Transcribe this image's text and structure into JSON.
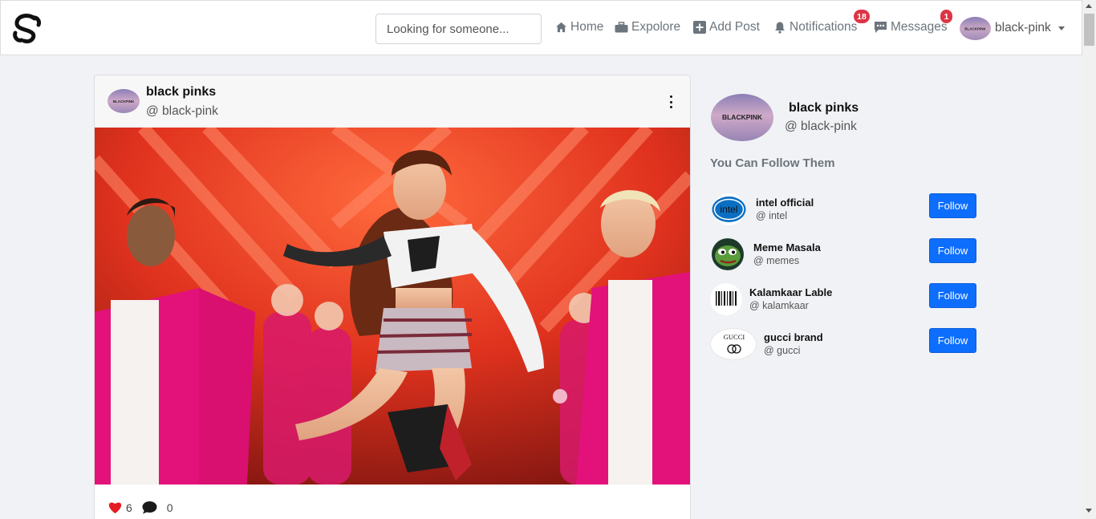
{
  "navbar": {
    "search_placeholder": "Looking for someone...",
    "items": [
      {
        "label": "Home",
        "icon": "home-icon"
      },
      {
        "label": "Expolore",
        "icon": "briefcase-icon"
      },
      {
        "label": "Add Post",
        "icon": "plus-square-icon"
      },
      {
        "label": "Notifications",
        "icon": "bell-icon",
        "badge": "18"
      },
      {
        "label": "Messages",
        "icon": "chat-icon",
        "badge": "1"
      }
    ],
    "user": {
      "username": "black-pink",
      "avatar_text": "BLACKPINK"
    },
    "accent_color": "#0d6efd",
    "badge_color": "#dc3545"
  },
  "post": {
    "author_name": "black pinks",
    "author_handle": "@ black-pink",
    "avatar_text": "BLACKPINK",
    "likes": "6",
    "comments": "0"
  },
  "sidebar": {
    "profile": {
      "name": "black pinks",
      "handle": "@ black-pink",
      "avatar_text": "BLACKPINK"
    },
    "follow_title": "You Can Follow Them",
    "suggestions": [
      {
        "name": "intel official",
        "handle": "@ intel",
        "button": "Follow",
        "avatar_text": "intel"
      },
      {
        "name": "Meme Masala",
        "handle": "@ memes",
        "button": "Follow"
      },
      {
        "name": "Kalamkaar Lable",
        "handle": "@ kalamkaar",
        "button": "Follow"
      },
      {
        "name": "gucci brand",
        "handle": "@ gucci",
        "button": "Follow",
        "avatar_text": "GUCCI"
      }
    ]
  }
}
